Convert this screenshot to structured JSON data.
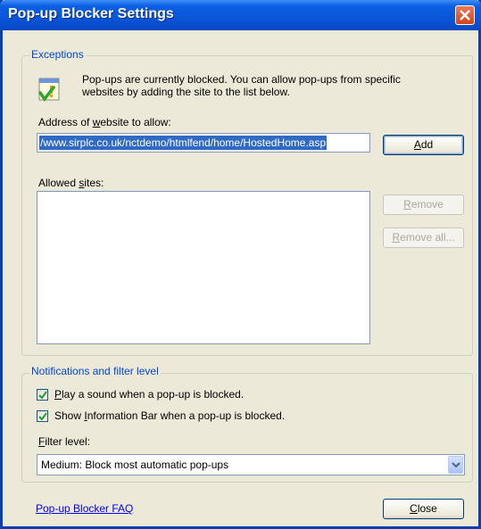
{
  "window": {
    "title": "Pop-up Blocker Settings"
  },
  "exceptions": {
    "group_label": "Exceptions",
    "info_line1": "Pop-ups are currently blocked.  You can allow pop-ups from specific",
    "info_line2": "websites by adding the site to the list below.",
    "address_label_pre": "Address of ",
    "address_label_accel": "w",
    "address_label_post": "ebsite to allow:",
    "address_value": "/www.sirplc.co.uk/nctdemo/htmlfend/home/HostedHome.asp",
    "add_button": {
      "accel": "A",
      "rest": "dd"
    },
    "allowed_label_pre": "Allowed ",
    "allowed_label_accel": "s",
    "allowed_label_post": "ites:",
    "allowed_sites": [],
    "remove_button": {
      "accel": "R",
      "rest": "emove"
    },
    "remove_all_button": {
      "accel": "R",
      "rest": "emove all..."
    }
  },
  "notifications": {
    "group_label": "Notifications and filter level",
    "play_sound": {
      "accel": "P",
      "rest": "lay a sound when a pop-up is blocked.",
      "checked": true
    },
    "show_infobar": {
      "pre": "Show ",
      "accel": "I",
      "rest": "nformation Bar when a pop-up is blocked.",
      "checked": true
    },
    "filter_label": {
      "accel": "F",
      "rest": "ilter level:"
    },
    "filter_value": "Medium: Block most automatic pop-ups"
  },
  "footer": {
    "faq_link": "Pop-up Blocker FAQ",
    "close_button": {
      "accel": "C",
      "rest": "lose"
    }
  },
  "colors": {
    "titlebar": "#0a55d8",
    "group_label": "#0046d5",
    "selection": "#316ac5",
    "link": "#0000ff"
  }
}
